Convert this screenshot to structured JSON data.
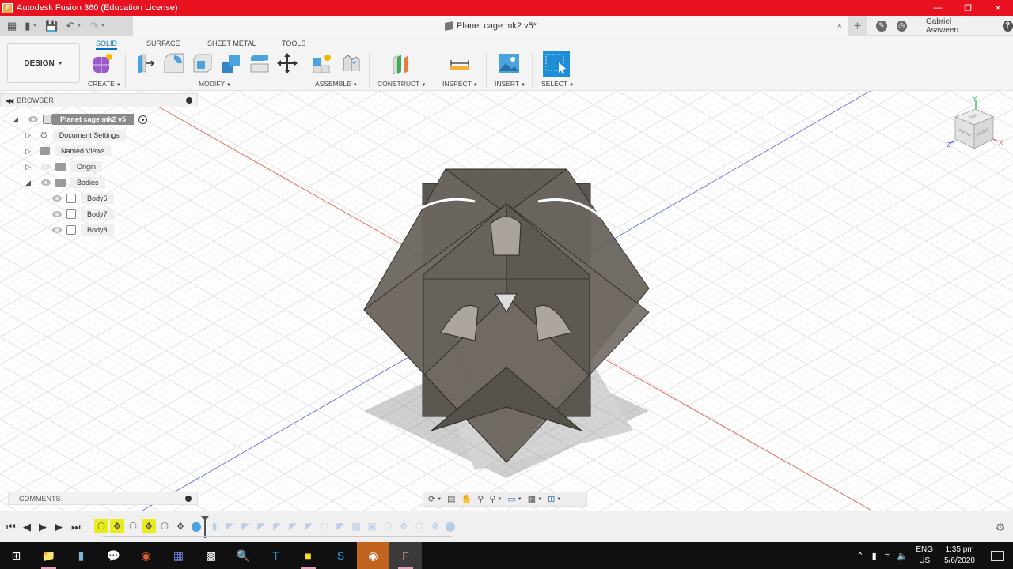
{
  "window": {
    "title": "Autodesk Fusion 360 (Education License)",
    "controls": [
      "minimize",
      "restore",
      "close"
    ]
  },
  "quick_access": {
    "icons": [
      "grid-icon",
      "file-icon",
      "save-icon",
      "undo-icon",
      "redo-icon"
    ]
  },
  "document_tab": {
    "title": "Planet cage mk2 v5*",
    "close": "×"
  },
  "top_right": {
    "user_name": "Gabriel Asaween",
    "help": "?"
  },
  "ribbon": {
    "workspace_label": "DESIGN",
    "tabs": [
      {
        "label": "SOLID",
        "active": true
      },
      {
        "label": "SURFACE",
        "active": false
      },
      {
        "label": "SHEET METAL",
        "active": false
      },
      {
        "label": "TOOLS",
        "active": false
      }
    ],
    "groups": [
      {
        "label": "CREATE"
      },
      {
        "label": "MODIFY"
      },
      {
        "label": "ASSEMBLE"
      },
      {
        "label": "CONSTRUCT"
      },
      {
        "label": "INSPECT"
      },
      {
        "label": "INSERT"
      },
      {
        "label": "SELECT"
      }
    ]
  },
  "browser": {
    "title": "BROWSER",
    "root": "Planet cage mk2 v5",
    "items": [
      {
        "label": "Document Settings",
        "expanded": false
      },
      {
        "label": "Named Views",
        "expanded": false
      },
      {
        "label": "Origin",
        "expanded": false,
        "visible": false
      },
      {
        "label": "Bodies",
        "expanded": true,
        "visible": true
      }
    ],
    "bodies": [
      "Body6",
      "Body7",
      "Body8"
    ]
  },
  "comments": {
    "title": "COMMENTS"
  },
  "viewcube": {
    "faces": [
      "TOP",
      "FRONT",
      "RIGHT"
    ],
    "axes": [
      "Y",
      "Z",
      "X"
    ]
  },
  "colors": {
    "titlebar": "#e8111f",
    "accent": "#0a6fb7",
    "model": "#5f5a54",
    "highlight": "#e8ec1b"
  },
  "taskbar": {
    "lang_top": "ENG",
    "lang_bottom": "US",
    "time": "1:35 pm",
    "date": "5/6/2020"
  }
}
